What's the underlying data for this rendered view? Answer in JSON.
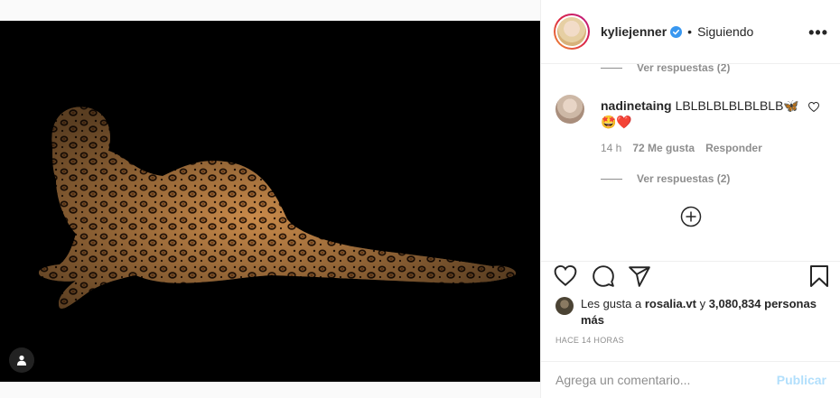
{
  "post": {
    "author": "kyliejenner",
    "verified": true,
    "separator": "•",
    "follow_status": "Siguiendo",
    "more_icon": "more-horizontal-icon",
    "more_label": "•••"
  },
  "comments": {
    "view_replies_top": "Ver respuestas (2)",
    "item": {
      "user": "nadinetaing",
      "text": "LBLBLBLBLBLBLB🦋🤩❤️",
      "time": "14 h",
      "likes": "72 Me gusta",
      "reply": "Responder",
      "view_replies": "Ver respuestas (2)"
    },
    "load_more_icon": "plus-circle-icon"
  },
  "actions": {
    "like_icon": "heart-outline-icon",
    "comment_icon": "comment-bubble-icon",
    "share_icon": "paper-plane-icon",
    "save_icon": "bookmark-icon"
  },
  "likes": {
    "prefix": "Les gusta a",
    "user": "rosalia.vt",
    "connector": "y",
    "count": "3,080,834 personas más"
  },
  "timestamp": "HACE 14 HORAS",
  "add_comment": {
    "placeholder": "Agrega un comentario...",
    "publish_label": "Publicar"
  },
  "colors": {
    "accent_blue": "#0095f6",
    "publish_disabled": "#b2dffc",
    "muted_text": "#8e8e8e",
    "heart_red": "#ed4956"
  }
}
